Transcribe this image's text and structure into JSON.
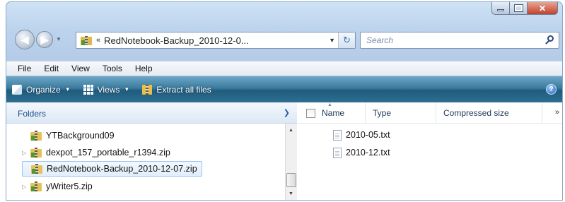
{
  "nav": {
    "address_chevron": "«",
    "address_path": "RedNotebook-Backup_2010-12-0...",
    "search_placeholder": "Search"
  },
  "menu": [
    "File",
    "Edit",
    "View",
    "Tools",
    "Help"
  ],
  "toolbar": {
    "organize": "Organize",
    "views": "Views",
    "extract": "Extract all files"
  },
  "folders": {
    "header": "Folders",
    "items": [
      {
        "label": "YTBackground09",
        "selected": false
      },
      {
        "label": "dexpot_157_portable_r1394.zip",
        "selected": false
      },
      {
        "label": "RedNotebook-Backup_2010-12-07.zip",
        "selected": true
      },
      {
        "label": "yWriter5.zip",
        "selected": false
      }
    ]
  },
  "columns": {
    "name": "Name",
    "type": "Type",
    "compressed_size": "Compressed size",
    "more": "»"
  },
  "files": [
    {
      "name": "2010-05.txt"
    },
    {
      "name": "2010-12.txt"
    }
  ]
}
